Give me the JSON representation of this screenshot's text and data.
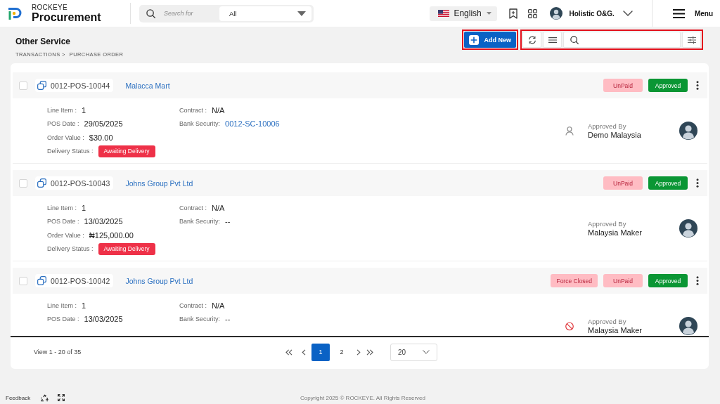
{
  "header": {
    "brand_tagline": "ROCKEYE",
    "brand_name": "Procurement",
    "search": {
      "placeholder": "Search for",
      "scope": "All"
    },
    "language": "English",
    "user_name": "Holistic O&G.",
    "menu_label": "Menu"
  },
  "page": {
    "title": "Other Service",
    "breadcrumb": [
      "TRANSACTIONS >",
      "PURCHASE ORDER"
    ],
    "add_button": {
      "label": "Add New",
      "highlighted": true
    },
    "tools": {
      "highlighted": true
    }
  },
  "orders": [
    {
      "checked": false,
      "number": "0012-POS-10044",
      "vendor": "Malacca Mart",
      "statuses": [
        {
          "label": "UnPaid",
          "kind": "unpaid"
        },
        {
          "label": "Approved",
          "kind": "approved"
        }
      ],
      "details": [
        {
          "label": "Line Item :",
          "value": "1",
          "kind": "text"
        },
        {
          "label": "POS Date :",
          "value": "29/05/2025",
          "kind": "text"
        },
        {
          "label": "Order Value :",
          "value": "$30.00",
          "kind": "text"
        },
        {
          "label": "Delivery Status :",
          "value": "Awaiting Delivery",
          "kind": "badge"
        }
      ],
      "terms": [
        {
          "label": "Contract :",
          "value": "N/A",
          "kind": "text"
        },
        {
          "label": "Bank Security:",
          "value": "0012-SC-10006",
          "kind": "link"
        }
      ],
      "approval": {
        "kind": "user",
        "label": "Approved By",
        "name": "Demo Malaysia"
      }
    },
    {
      "checked": false,
      "number": "0012-POS-10043",
      "vendor": "Johns Group Pvt Ltd",
      "statuses": [
        {
          "label": "UnPaid",
          "kind": "unpaid"
        },
        {
          "label": "Approved",
          "kind": "approved"
        }
      ],
      "details": [
        {
          "label": "Line Item :",
          "value": "1",
          "kind": "text"
        },
        {
          "label": "POS Date :",
          "value": "13/03/2025",
          "kind": "text"
        },
        {
          "label": "Order Value :",
          "value": "₦125,000.00",
          "kind": "text"
        },
        {
          "label": "Delivery Status :",
          "value": "Awaiting Delivery",
          "kind": "badge"
        }
      ],
      "terms": [
        {
          "label": "Contract :",
          "value": "N/A",
          "kind": "text"
        },
        {
          "label": "Bank Security:",
          "value": "--",
          "kind": "text"
        }
      ],
      "approval": {
        "label": "Approved By",
        "name": "Malaysia Maker"
      }
    },
    {
      "checked": false,
      "number": "0012-POS-10042",
      "vendor": "Johns Group Pvt Ltd",
      "statuses": [
        {
          "label": "Force Closed",
          "kind": "closed"
        },
        {
          "label": "UnPaid",
          "kind": "unpaid"
        },
        {
          "label": "Approved",
          "kind": "approved"
        }
      ],
      "details": [
        {
          "label": "Line Item :",
          "value": "1",
          "kind": "text"
        },
        {
          "label": "POS Date :",
          "value": "13/03/2025",
          "kind": "text"
        }
      ],
      "terms": [
        {
          "label": "Contract :",
          "value": "N/A",
          "kind": "text"
        },
        {
          "label": "Bank Security:",
          "value": "--",
          "kind": "text"
        }
      ],
      "approval": {
        "kind": "blocked",
        "label": "Approved By",
        "name": "Malaysia Maker"
      }
    }
  ],
  "pagination": {
    "summary": "View 1 - 20 of 35",
    "pages": [
      {
        "label": "1",
        "selected": true
      },
      {
        "label": "2",
        "selected": false
      }
    ],
    "page_size": "20"
  },
  "footer": {
    "feedback": "Feedback",
    "copyright": "Copyright 2025 © ROCKEYE. All Rights Reserved"
  }
}
